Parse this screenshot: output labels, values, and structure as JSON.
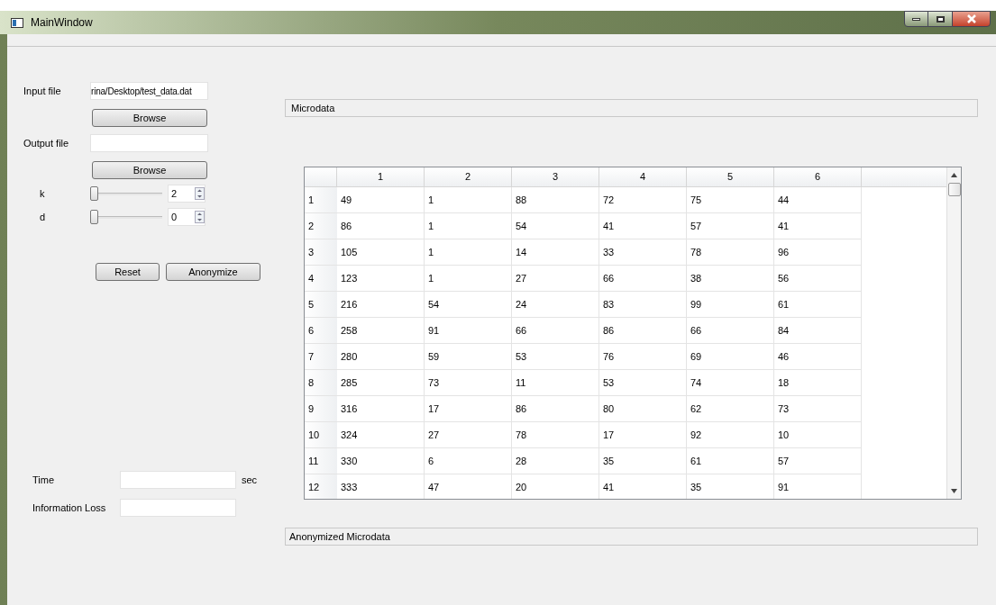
{
  "window": {
    "title": "MainWindow"
  },
  "form": {
    "input_file": {
      "label": "Input file",
      "value": "rina/Desktop/test_data.dat",
      "button": "Browse"
    },
    "output_file": {
      "label": "Output file",
      "button": "Browse"
    },
    "params": [
      {
        "label": "k",
        "level": 0,
        "value": "2"
      },
      {
        "label": "d",
        "level": 0,
        "value": "0"
      }
    ],
    "actions": [
      "Reset",
      "Anonymize"
    ],
    "time": {
      "label": "Time",
      "unit": "sec"
    },
    "information_loss": {
      "label": "Information Loss"
    }
  },
  "microdata": {
    "title": "Microdata",
    "columns": [
      "1",
      "2",
      "3",
      "4",
      "5",
      "6"
    ],
    "rows": [
      {
        "header": "1",
        "cells": [
          "49",
          "1",
          "88",
          "72",
          "75",
          "44"
        ]
      },
      {
        "header": "2",
        "cells": [
          "86",
          "1",
          "54",
          "41",
          "57",
          "41"
        ]
      },
      {
        "header": "3",
        "cells": [
          "105",
          "1",
          "14",
          "33",
          "78",
          "96"
        ]
      },
      {
        "header": "4",
        "cells": [
          "123",
          "1",
          "27",
          "66",
          "38",
          "56"
        ]
      },
      {
        "header": "5",
        "cells": [
          "216",
          "54",
          "24",
          "83",
          "99",
          "61"
        ]
      },
      {
        "header": "6",
        "cells": [
          "258",
          "91",
          "66",
          "86",
          "66",
          "84"
        ]
      },
      {
        "header": "7",
        "cells": [
          "280",
          "59",
          "53",
          "76",
          "69",
          "46"
        ]
      },
      {
        "header": "8",
        "cells": [
          "285",
          "73",
          "11",
          "53",
          "74",
          "18"
        ]
      },
      {
        "header": "9",
        "cells": [
          "316",
          "17",
          "86",
          "80",
          "62",
          "73"
        ]
      },
      {
        "header": "10",
        "cells": [
          "324",
          "27",
          "78",
          "17",
          "92",
          "10"
        ]
      },
      {
        "header": "11",
        "cells": [
          "330",
          "6",
          "28",
          "35",
          "61",
          "57"
        ]
      },
      {
        "header": "12",
        "cells": [
          "333",
          "47",
          "20",
          "41",
          "35",
          "91"
        ]
      }
    ]
  },
  "anonymized": {
    "title": "Anonymized Microdata"
  }
}
